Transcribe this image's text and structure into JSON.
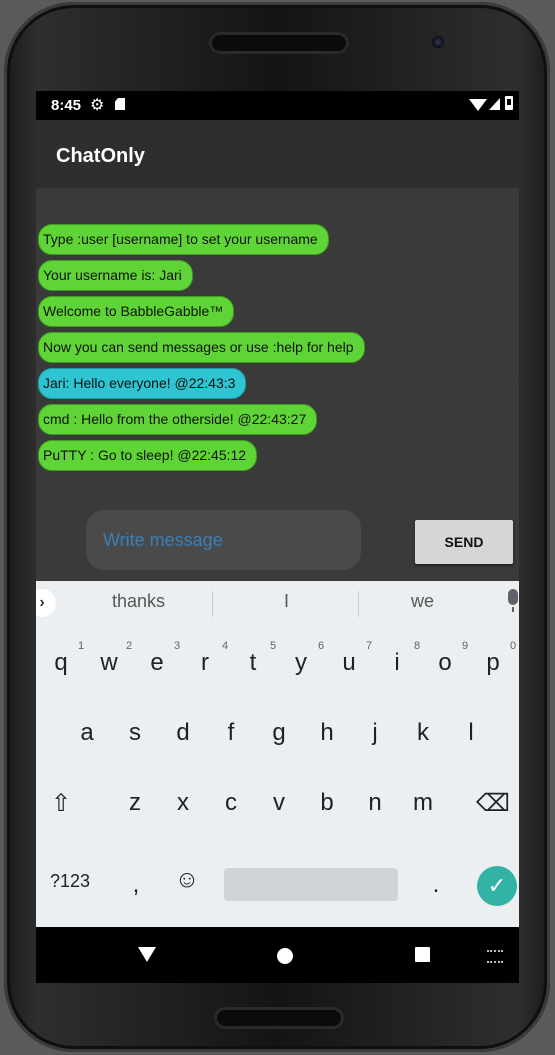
{
  "status_bar": {
    "time": "8:45"
  },
  "app_bar": {
    "title": "ChatOnly"
  },
  "messages": [
    {
      "text": "Type :user [username] to set your username",
      "kind": "system"
    },
    {
      "text": "Your username is: Jari",
      "kind": "system"
    },
    {
      "text": "Welcome to BabbleGabble™",
      "kind": "system"
    },
    {
      "text": "Now you can send messages or use :help for help",
      "kind": "system"
    },
    {
      "text": "Jari: Hello everyone! @22:43:3",
      "kind": "self"
    },
    {
      "text": "cmd : Hello from the otherside! @22:43:27",
      "kind": "other"
    },
    {
      "text": "PuTTY : Go to sleep! @22:45:12",
      "kind": "other"
    }
  ],
  "composer": {
    "placeholder": "Write message",
    "send_label": "SEND"
  },
  "keyboard": {
    "suggestions": [
      "thanks",
      "I",
      "we"
    ],
    "row1": [
      "q",
      "w",
      "e",
      "r",
      "t",
      "y",
      "u",
      "i",
      "o",
      "p"
    ],
    "row1_hints": [
      "1",
      "2",
      "3",
      "4",
      "5",
      "6",
      "7",
      "8",
      "9",
      "0"
    ],
    "row2": [
      "a",
      "s",
      "d",
      "f",
      "g",
      "h",
      "j",
      "k",
      "l"
    ],
    "row3": [
      "z",
      "x",
      "c",
      "v",
      "b",
      "n",
      "m"
    ],
    "symbols_label": "?123",
    "comma": ",",
    "period": "."
  },
  "colors": {
    "system_bubble": "#5fd436",
    "self_bubble": "#2fc4d1",
    "enter_key": "#33b3a6"
  }
}
